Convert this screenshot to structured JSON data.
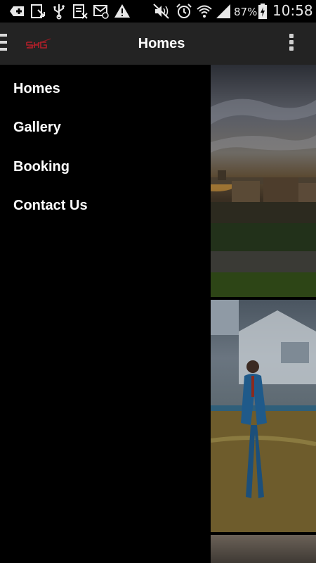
{
  "status_bar": {
    "battery_percent": "87%",
    "time": "10:58",
    "icons": [
      "add-notification-icon",
      "download-icon",
      "usb-icon",
      "file-icon",
      "email-icon",
      "warning-icon",
      "mute-icon",
      "alarm-icon",
      "wifi-icon",
      "signal-icon",
      "battery-charging-icon"
    ]
  },
  "app_bar": {
    "title": "Homes",
    "logo_text": "SHG",
    "colors": {
      "background": "#232323",
      "title": "#ffffff",
      "logo": "#b0202a"
    }
  },
  "drawer": {
    "items": [
      {
        "label": "Homes"
      },
      {
        "label": "Gallery"
      },
      {
        "label": "Booking"
      },
      {
        "label": "Contact Us"
      }
    ],
    "colors": {
      "background": "#000000",
      "text": "#ffffff"
    }
  },
  "content": {
    "images": [
      "city-skyline-photo",
      "man-in-blue-suit-photo",
      "third-photo"
    ]
  }
}
